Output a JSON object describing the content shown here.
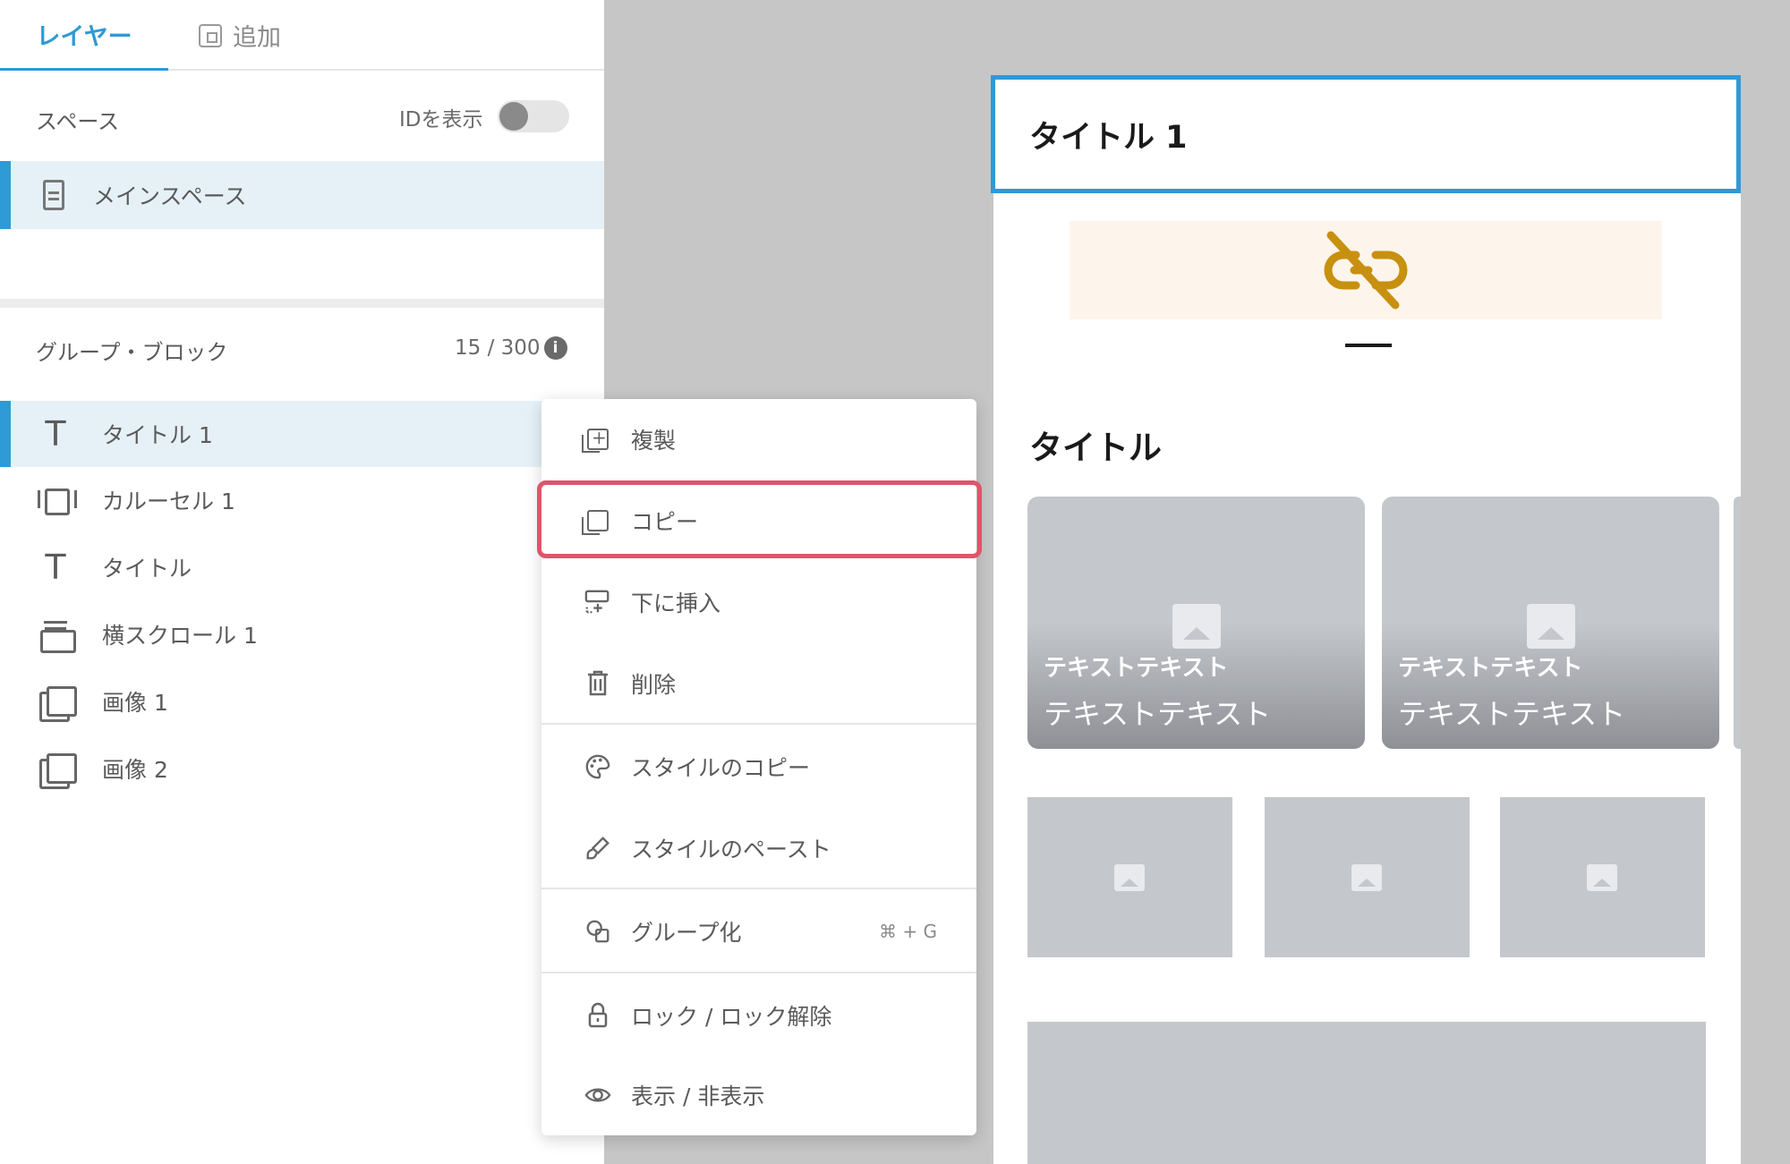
{
  "tabs": {
    "layers": "レイヤー",
    "add": "追加"
  },
  "space_section": {
    "label": "スペース",
    "show_id_label": "IDを表示",
    "show_id_on": false,
    "main_space": "メインスペース"
  },
  "group_section": {
    "label": "グループ・ブロック",
    "count": "15 / 300",
    "layers": [
      {
        "label": "タイトル 1",
        "icon": "text-icon",
        "selected": true
      },
      {
        "label": "カルーセル 1",
        "icon": "carousel-icon"
      },
      {
        "label": "タイトル",
        "icon": "text-icon"
      },
      {
        "label": "横スクロール 1",
        "icon": "horizontal-scroll-icon"
      },
      {
        "label": "画像 1",
        "icon": "image-icon"
      },
      {
        "label": "画像 2",
        "icon": "image-icon"
      }
    ]
  },
  "context_menu": {
    "duplicate": "複製",
    "copy": "コピー",
    "insert_below": "下に挿入",
    "delete": "削除",
    "copy_style": "スタイルのコピー",
    "paste_style": "スタイルのペースト",
    "group": "グループ化",
    "group_shortcut": "⌘ + G",
    "lock": "ロック / ロック解除",
    "visibility": "表示 / 非表示"
  },
  "preview": {
    "title_block": "タイトル 1",
    "section_title": "タイトル",
    "cards": [
      {
        "title": "テキストテキスト",
        "subtitle": "テキストテキスト"
      },
      {
        "title": "テキストテキスト",
        "subtitle": "テキストテキスト"
      }
    ]
  },
  "colors": {
    "accent": "#2e9ad6",
    "highlight": "#e0546a",
    "broken_link": "#c8900f",
    "placeholder": "#c4c7cc"
  }
}
